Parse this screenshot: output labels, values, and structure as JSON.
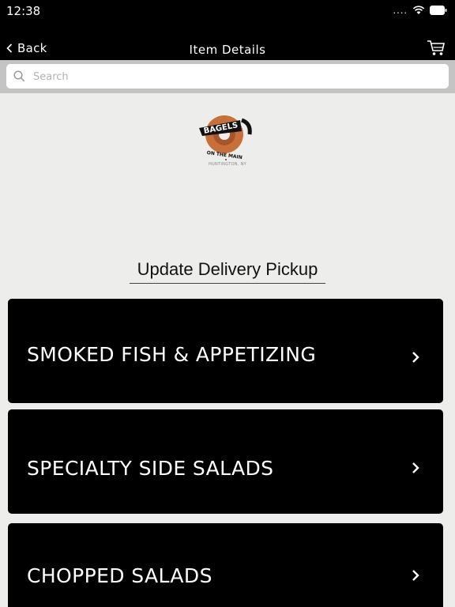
{
  "status_bar": {
    "time": "12:38",
    "signal": "....",
    "icons": [
      "wifi-icon",
      "battery-icon"
    ]
  },
  "nav": {
    "back_label": "Back",
    "title": "Item Details",
    "cart_icon": "cart-icon"
  },
  "search": {
    "placeholder": "Search",
    "value": ""
  },
  "logo": {
    "text_top": "BAGELS",
    "text_bottom": "ON THE MAIN",
    "location": "HUNTINGTON, NY",
    "colors": {
      "bagel": "#c8703a",
      "ink": "#111111"
    }
  },
  "update_link": "Update Delivery Pickup",
  "categories": [
    {
      "label": "SMOKED FISH & APPETIZING"
    },
    {
      "label": "SPECIALTY SIDE SALADS"
    },
    {
      "label": "CHOPPED SALADS"
    }
  ],
  "colors": {
    "bar_bg": "#000000",
    "page_bg": "#ededeb",
    "search_band": "#c4c4c4",
    "card_bg": "#000000",
    "card_text": "#ffffff"
  }
}
